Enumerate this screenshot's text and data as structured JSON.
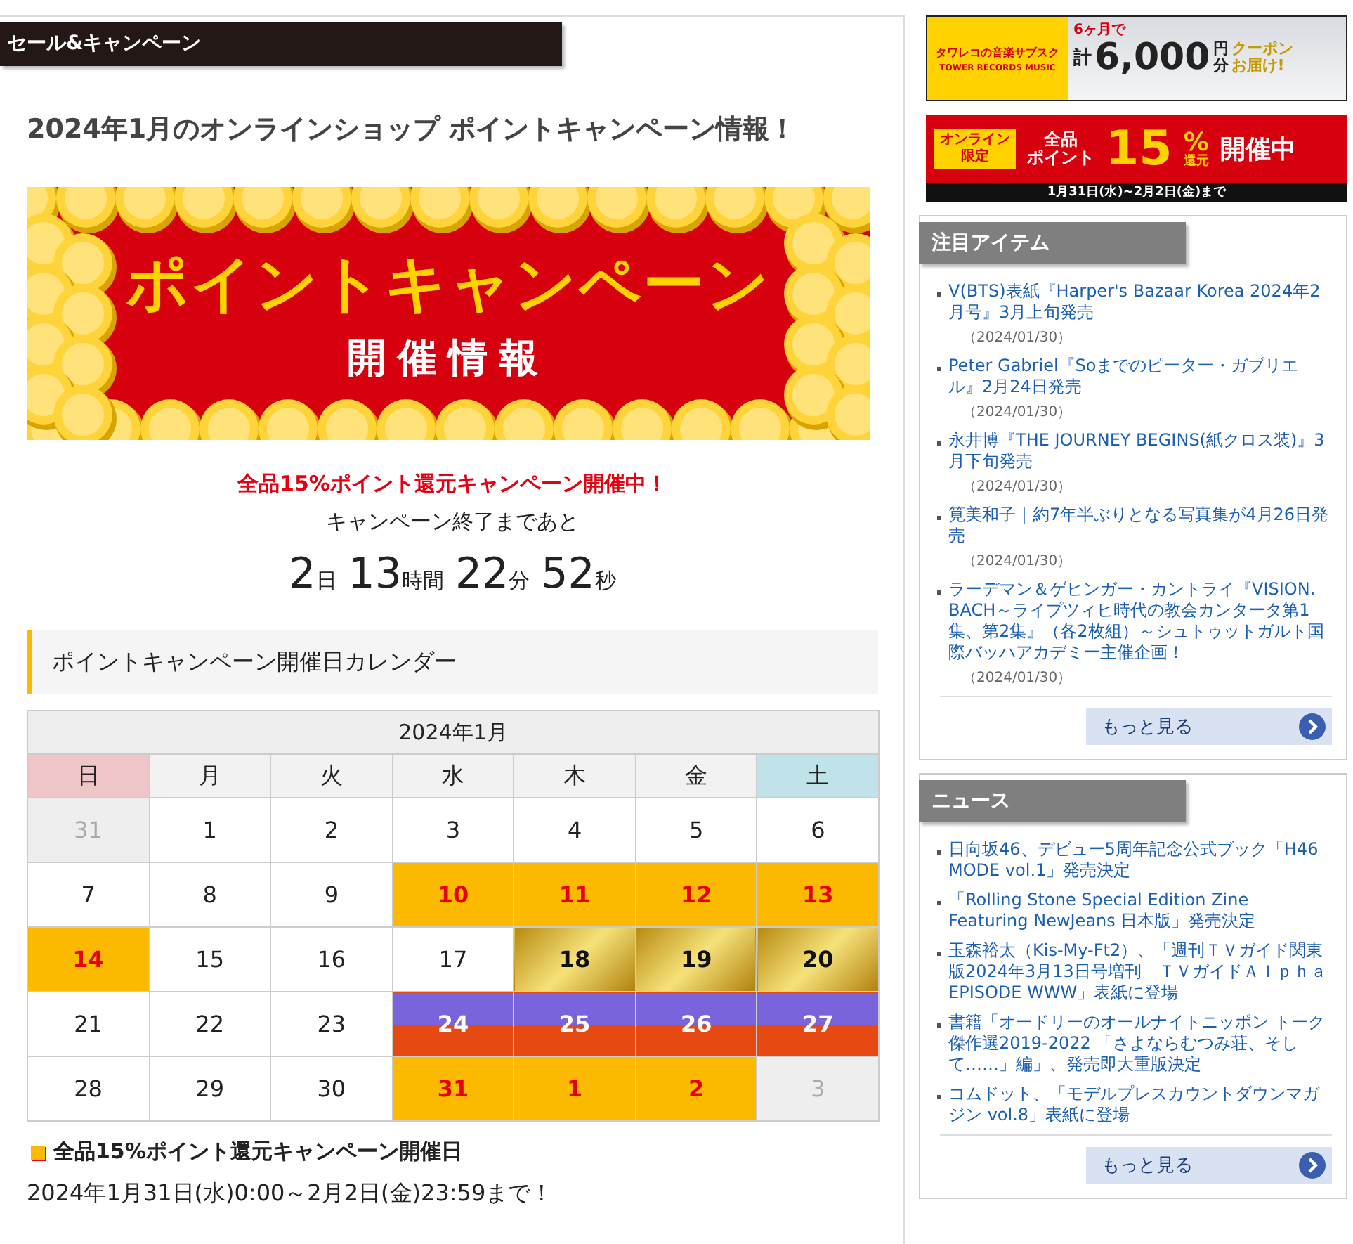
{
  "section_header": "セール&キャンペーン",
  "title": "2024年1月のオンラインショップ ポイントキャンペーン情報！",
  "hero_banner": {
    "headline": "ポイントキャンペーン",
    "subline": "開催情報"
  },
  "campaign_notice": "全品15%ポイント還元キャンペーン開催中！",
  "countdown_label": "キャンペーン終了まであと",
  "countdown": [
    {
      "num": "2",
      "unit": "日"
    },
    {
      "num": "13",
      "unit": "時間"
    },
    {
      "num": "22",
      "unit": "分"
    },
    {
      "num": "52",
      "unit": "秒"
    }
  ],
  "calendar_heading": "ポイントキャンペーン開催日カレンダー",
  "calendar": {
    "month": "2024年1月",
    "weekdays": [
      {
        "label": "日",
        "kind": "sun"
      },
      {
        "label": "月",
        "kind": "weekday"
      },
      {
        "label": "火",
        "kind": "weekday"
      },
      {
        "label": "水",
        "kind": "weekday"
      },
      {
        "label": "木",
        "kind": "weekday"
      },
      {
        "label": "金",
        "kind": "weekday"
      },
      {
        "label": "土",
        "kind": "sat"
      }
    ],
    "weeks": [
      [
        {
          "day": "31",
          "kind": "other"
        },
        {
          "day": "1",
          "kind": "normal"
        },
        {
          "day": "2",
          "kind": "normal"
        },
        {
          "day": "3",
          "kind": "normal"
        },
        {
          "day": "4",
          "kind": "normal"
        },
        {
          "day": "5",
          "kind": "normal"
        },
        {
          "day": "6",
          "kind": "normal"
        }
      ],
      [
        {
          "day": "7",
          "kind": "normal"
        },
        {
          "day": "8",
          "kind": "normal"
        },
        {
          "day": "9",
          "kind": "normal"
        },
        {
          "day": "10",
          "kind": "yellow"
        },
        {
          "day": "11",
          "kind": "yellow"
        },
        {
          "day": "12",
          "kind": "yellow"
        },
        {
          "day": "13",
          "kind": "yellow"
        }
      ],
      [
        {
          "day": "14",
          "kind": "yellow"
        },
        {
          "day": "15",
          "kind": "normal"
        },
        {
          "day": "16",
          "kind": "normal"
        },
        {
          "day": "17",
          "kind": "normal"
        },
        {
          "day": "18",
          "kind": "gold"
        },
        {
          "day": "19",
          "kind": "gold"
        },
        {
          "day": "20",
          "kind": "gold"
        }
      ],
      [
        {
          "day": "21",
          "kind": "normal"
        },
        {
          "day": "22",
          "kind": "normal"
        },
        {
          "day": "23",
          "kind": "normal"
        },
        {
          "day": "24",
          "kind": "split"
        },
        {
          "day": "25",
          "kind": "split"
        },
        {
          "day": "26",
          "kind": "split"
        },
        {
          "day": "27",
          "kind": "split"
        }
      ],
      [
        {
          "day": "28",
          "kind": "normal"
        },
        {
          "day": "29",
          "kind": "normal"
        },
        {
          "day": "30",
          "kind": "normal"
        },
        {
          "day": "31",
          "kind": "yellow"
        },
        {
          "day": "1",
          "kind": "yellow"
        },
        {
          "day": "2",
          "kind": "yellow"
        },
        {
          "day": "3",
          "kind": "other"
        }
      ]
    ]
  },
  "campaign_period": {
    "heading": "全品15%ポイント還元キャンペーン開催日",
    "text": "2024年1月31日(水)0:00～2月2日(金)23:59まで！"
  },
  "sidebar": {
    "subscription_banner": {
      "brand": "タワレコの音楽サブスク",
      "brand_en": "TOWER RECORDS MUSIC",
      "lead": "6ヶ月で",
      "prefix": "計",
      "amount": "6,000",
      "unit_top": "円",
      "unit_bottom": "分",
      "tail_top": "クーポン",
      "tail_bottom": "お届け!"
    },
    "points_banner": {
      "tag_top": "オンライン",
      "tag_bottom": "限定",
      "line1": "全品",
      "line2": "ポイント",
      "big": "15",
      "pct": "%",
      "pct_sub": "還元",
      "tail": "開催中",
      "period": "1月31日(水)~2月2日(金)まで"
    },
    "boxes": [
      {
        "title": "注目アイテム",
        "items": [
          {
            "text": "V(BTS)表紙『Harper's Bazaar Korea 2024年2月号』3月上旬発売",
            "date": "（2024/01/30）"
          },
          {
            "text": "Peter Gabriel『Soまでのピーター・ガブリエル』2月24日発売",
            "date": "（2024/01/30）"
          },
          {
            "text": "永井博『THE JOURNEY BEGINS(紙クロス装)』3月下旬発売",
            "date": "（2024/01/30）"
          },
          {
            "text": "筧美和子｜約7年半ぶりとなる写真集が4月26日発売",
            "date": "（2024/01/30）"
          },
          {
            "text": "ラーデマン＆ゲヒンガー・カントライ『VISION. BACH～ライプツィヒ時代の教会カンタータ第1集、第2集』（各2枚組）～シュトゥットガルト国際バッハアカデミー主催企画！",
            "date": "（2024/01/30）"
          }
        ],
        "more": "もっと見る"
      },
      {
        "title": "ニュース",
        "items": [
          {
            "text": "日向坂46、デビュー5周年記念公式ブック「H46 MODE vol.1」発売決定"
          },
          {
            "text": "「Rolling Stone Special Edition Zine Featuring NewJeans 日本版」発売決定"
          },
          {
            "text": "玉森裕太（Kis-My-Ft2）、「週刊ＴＶガイド関東版2024年3月13日号増刊　ＴＶガイドＡｌｐｈａ EPISODE WWW」表紙に登場"
          },
          {
            "text": "書籍「オードリーのオールナイトニッポン トーク傑作選2019-2022 「さよならむつみ荘、そして……」編」、発売即大重版決定"
          },
          {
            "text": "コムドット、「モデルプレスカウントダウンマガジン vol.8」表紙に登場"
          }
        ],
        "more": "もっと見る"
      }
    ]
  }
}
